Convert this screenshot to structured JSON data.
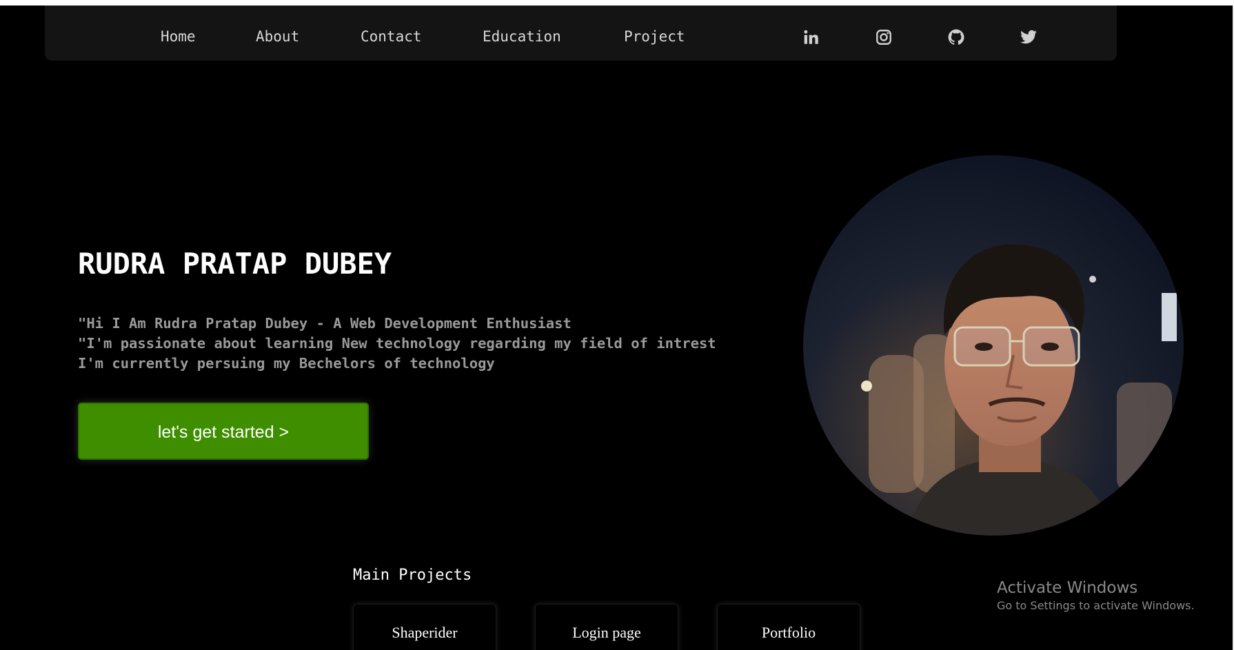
{
  "nav": {
    "links": [
      "Home",
      "About",
      "Contact",
      "Education",
      "Project"
    ],
    "socials": [
      "linkedin-icon",
      "instagram-icon",
      "github-icon",
      "twitter-icon"
    ]
  },
  "hero": {
    "name": "RUDRA PRATAP DUBEY",
    "lines": [
      "\"Hi I Am Rudra Pratap Dubey - A Web Development Enthusiast",
      "\"I'm passionate about learning New technology regarding my field of intrest",
      "I'm currently persuing my Bechelors of technology"
    ],
    "cta_label": "let's get started >"
  },
  "projects": {
    "title": "Main Projects",
    "items": [
      "Shaperider",
      "Login page",
      "Portfolio"
    ]
  },
  "watermark": {
    "title": "Activate Windows",
    "subtitle": "Go to Settings to activate Windows."
  },
  "colors": {
    "background": "#000000",
    "navbar": "#141414",
    "cta": "#3e8e00",
    "muted_text": "#9a9a9a"
  }
}
